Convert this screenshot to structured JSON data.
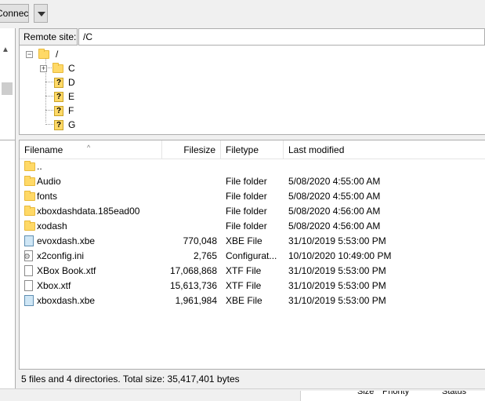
{
  "toolbar": {
    "connect_label": "Connect"
  },
  "remote": {
    "site_label": "Remote site:",
    "path": "/C",
    "tree": [
      {
        "label": "/",
        "kind": "folder"
      },
      {
        "label": "C",
        "kind": "folder"
      },
      {
        "label": "D",
        "kind": "unknown"
      },
      {
        "label": "E",
        "kind": "unknown"
      },
      {
        "label": "F",
        "kind": "unknown"
      },
      {
        "label": "G",
        "kind": "unknown"
      }
    ],
    "columns": {
      "filename": "Filename",
      "filesize": "Filesize",
      "filetype": "Filetype",
      "last_modified": "Last modified"
    },
    "rows": [
      {
        "name": "..",
        "size": "",
        "type": "",
        "modified": "",
        "icon": "folder-icon"
      },
      {
        "name": "Audio",
        "size": "",
        "type": "File folder",
        "modified": "5/08/2020 4:55:00 AM",
        "icon": "folder-icon"
      },
      {
        "name": "fonts",
        "size": "",
        "type": "File folder",
        "modified": "5/08/2020 4:55:00 AM",
        "icon": "folder-icon"
      },
      {
        "name": "xboxdashdata.185ead00",
        "size": "",
        "type": "File folder",
        "modified": "5/08/2020 4:56:00 AM",
        "icon": "folder-icon"
      },
      {
        "name": "xodash",
        "size": "",
        "type": "File folder",
        "modified": "5/08/2020 4:56:00 AM",
        "icon": "folder-icon"
      },
      {
        "name": "evoxdash.xbe",
        "size": "770,048",
        "type": "XBE File",
        "modified": "31/10/2019 5:53:00 PM",
        "icon": "xbe-file-icon"
      },
      {
        "name": "x2config.ini",
        "size": "2,765",
        "type": "Configurat...",
        "modified": "10/10/2020 10:49:00 PM",
        "icon": "ini-file-icon"
      },
      {
        "name": "XBox Book.xtf",
        "size": "17,068,868",
        "type": "XTF File",
        "modified": "31/10/2019 5:53:00 PM",
        "icon": "file-icon"
      },
      {
        "name": "Xbox.xtf",
        "size": "15,613,736",
        "type": "XTF File",
        "modified": "31/10/2019 5:53:00 PM",
        "icon": "file-icon"
      },
      {
        "name": "xboxdash.xbe",
        "size": "1,961,984",
        "type": "XBE File",
        "modified": "31/10/2019 5:53:00 PM",
        "icon": "xbe-file-icon"
      }
    ],
    "status": "5 files and 4 directories. Total size: 35,417,401 bytes"
  },
  "queue": {
    "columns": [
      "Size",
      "Priority",
      "Status"
    ]
  }
}
